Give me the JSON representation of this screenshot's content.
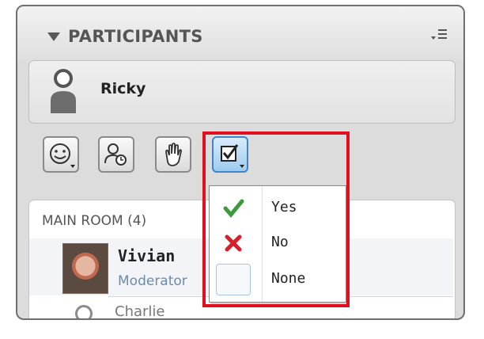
{
  "panel": {
    "title": "PARTICIPANTS",
    "accent_color": "#3e86c8",
    "highlight_color": "#e01020"
  },
  "current_user": {
    "name": "Ricky",
    "icon": "user-silhouette-icon"
  },
  "toolbar": {
    "buttons": [
      {
        "name": "emoticon-button",
        "icon": "smiley-icon",
        "has_dropdown": true
      },
      {
        "name": "away-button",
        "icon": "person-clock-icon",
        "has_dropdown": false
      },
      {
        "name": "raise-hand-button",
        "icon": "hand-icon",
        "has_dropdown": false
      },
      {
        "name": "agree-disagree-button",
        "icon": "checkbox-check-icon",
        "has_dropdown": true,
        "selected": true
      }
    ]
  },
  "status_menu": {
    "items": [
      {
        "label": "Yes",
        "icon": "green-check-icon",
        "color": "#3c9a3c"
      },
      {
        "label": "No",
        "icon": "red-x-icon",
        "color": "#d8202a"
      },
      {
        "label": "None",
        "icon": "empty-box-icon"
      }
    ]
  },
  "room": {
    "name": "MAIN ROOM",
    "count": "(4)",
    "participants": [
      {
        "name": "Vivian",
        "role": "Moderator",
        "icon": "user-photo-icon"
      },
      {
        "name": "Charlie",
        "role": "",
        "icon": "user-outline-icon"
      }
    ]
  }
}
